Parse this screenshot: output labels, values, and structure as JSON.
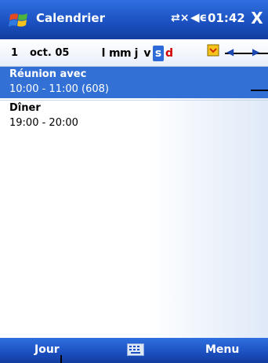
{
  "title_bar": {
    "app_title": "Calendrier",
    "clock": "01:42",
    "close_label": "X"
  },
  "date_bar": {
    "day_number": "1",
    "month_year": "oct. 05",
    "days": [
      {
        "letter": "l",
        "selected": false
      },
      {
        "letter": "m",
        "selected": false
      },
      {
        "letter": "m",
        "selected": false
      },
      {
        "letter": "j",
        "selected": false
      },
      {
        "letter": "v",
        "selected": false
      },
      {
        "letter": "s",
        "selected": true
      },
      {
        "letter": "d",
        "selected": false
      }
    ],
    "today_icon": "today-calendar-icon"
  },
  "appointments": [
    {
      "title": "Réunion avec",
      "time": "10:00 - 11:00 (608)",
      "selected": true
    },
    {
      "title": "Dîner",
      "time": "19:00 - 20:00",
      "selected": false
    }
  ],
  "menu_bar": {
    "left_softkey": "Jour",
    "right_softkey": "Menu",
    "input_icon": "keyboard-icon"
  },
  "colors": {
    "bar_blue": "#1b4fbf",
    "selection_blue": "#3270d5",
    "sunday_red": "#d00000"
  }
}
